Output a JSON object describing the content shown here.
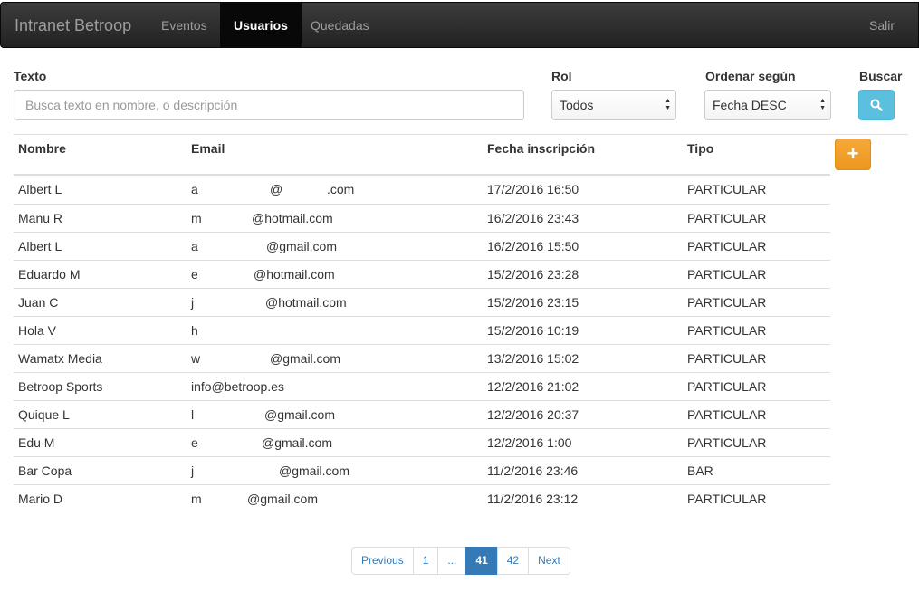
{
  "navbar": {
    "brand": "Intranet Betroop",
    "items": [
      {
        "label": "Eventos"
      },
      {
        "label": "Usuarios",
        "active": true
      },
      {
        "label": "Quedadas"
      }
    ],
    "logout": "Salir"
  },
  "filters": {
    "text_label": "Texto",
    "text_placeholder": "Busca texto en nombre, o descripción",
    "role_label": "Rol",
    "role_value": "Todos",
    "sort_label": "Ordenar según",
    "sort_value": "Fecha DESC",
    "search_label": "Buscar"
  },
  "colors": {
    "search_button": "#5bc0de",
    "add_button": "#f0ad4e",
    "active_page": "#337ab7"
  },
  "table": {
    "headers": [
      "Nombre",
      "Email",
      "Fecha inscripción",
      "Tipo"
    ],
    "rows": [
      {
        "nombre": "Albert L",
        "email_a": "a",
        "email_b": "@",
        "email_c": ".com",
        "fecha": "17/2/2016 16:50",
        "tipo": "PARTICULAR"
      },
      {
        "nombre": "Manu R",
        "email_a": "m",
        "email_b": "@hotmail.com",
        "email_c": "",
        "fecha": "16/2/2016 23:43",
        "tipo": "PARTICULAR"
      },
      {
        "nombre": "Albert L",
        "email_a": "a",
        "email_b": "@gmail.com",
        "email_c": "",
        "fecha": "16/2/2016 15:50",
        "tipo": "PARTICULAR"
      },
      {
        "nombre": "Eduardo M",
        "email_a": "e",
        "email_b": "@hotmail.com",
        "email_c": "",
        "fecha": "15/2/2016 23:28",
        "tipo": "PARTICULAR"
      },
      {
        "nombre": "Juan C",
        "email_a": "j",
        "email_b": "@hotmail.com",
        "email_c": "",
        "fecha": "15/2/2016 23:15",
        "tipo": "PARTICULAR"
      },
      {
        "nombre": "Hola V",
        "email_a": "h",
        "email_b": "",
        "email_c": "",
        "fecha": "15/2/2016 10:19",
        "tipo": "PARTICULAR"
      },
      {
        "nombre": "Wamatx Media",
        "email_a": "w",
        "email_b": "@gmail.com",
        "email_c": "",
        "fecha": "13/2/2016 15:02",
        "tipo": "PARTICULAR"
      },
      {
        "nombre": "Betroop Sports",
        "email_a": "info@betroop.es",
        "email_b": "",
        "email_c": "",
        "fecha": "12/2/2016 21:02",
        "tipo": "PARTICULAR"
      },
      {
        "nombre": "Quique L",
        "email_a": "l",
        "email_b": "@gmail.com",
        "email_c": "",
        "fecha": "12/2/2016 20:37",
        "tipo": "PARTICULAR"
      },
      {
        "nombre": "Edu M",
        "email_a": "e",
        "email_b": "@gmail.com",
        "email_c": "",
        "fecha": "12/2/2016 1:00",
        "tipo": "PARTICULAR"
      },
      {
        "nombre": "Bar Copa",
        "email_a": "j",
        "email_b": "@gmail.com",
        "email_c": "",
        "fecha": "11/2/2016 23:46",
        "tipo": "BAR"
      },
      {
        "nombre": "Mario D",
        "email_a": "m",
        "email_b": "@gmail.com",
        "email_c": "",
        "fecha": "11/2/2016 23:12",
        "tipo": "PARTICULAR"
      }
    ]
  },
  "pagination": {
    "pages": [
      {
        "label": "Previous"
      },
      {
        "label": "1"
      },
      {
        "label": "..."
      },
      {
        "label": "41",
        "active": true
      },
      {
        "label": "42"
      },
      {
        "label": "Next"
      }
    ]
  }
}
